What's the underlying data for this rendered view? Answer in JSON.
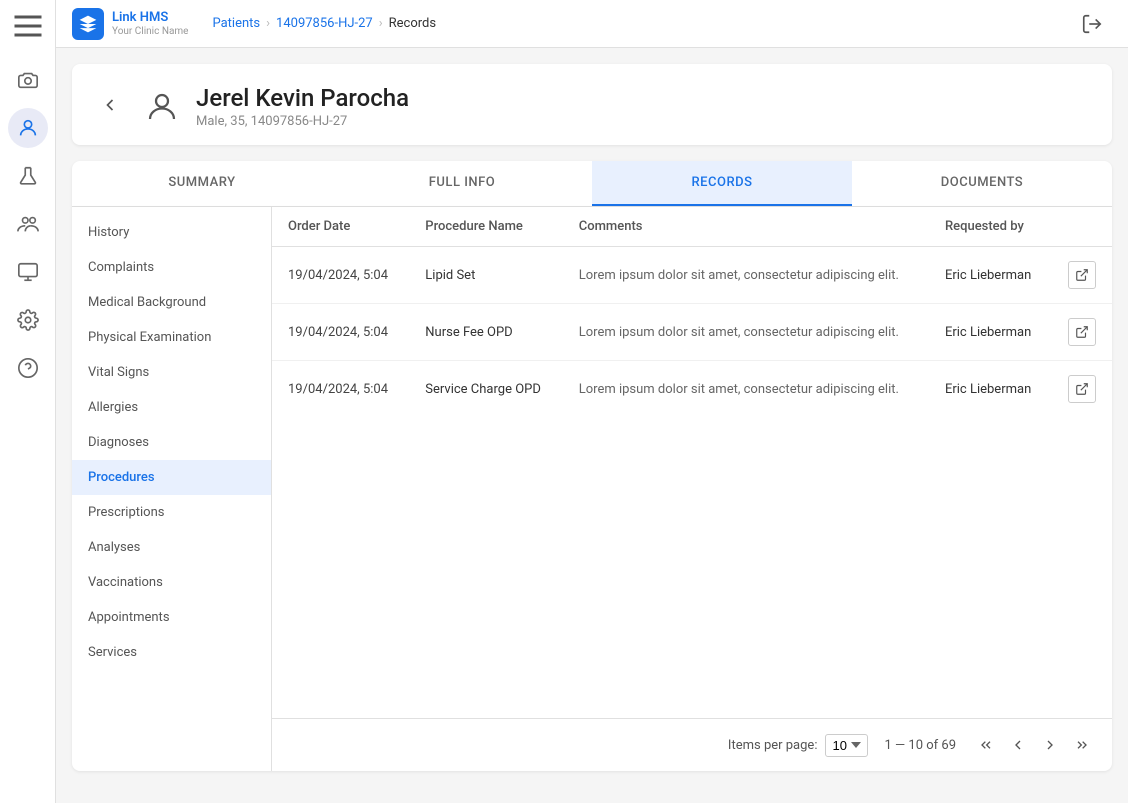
{
  "app": {
    "title": "Link HMS",
    "subtitle": "Your Clinic Name"
  },
  "breadcrumb": {
    "patients": "Patients",
    "patient_id": "14097856-HJ-27",
    "current": "Records"
  },
  "patient": {
    "name": "Jerel Kevin Parocha",
    "meta": "Male, 35, 14097856-HJ-27"
  },
  "tabs": [
    {
      "label": "SUMMARY",
      "active": false
    },
    {
      "label": "FULL INFO",
      "active": false
    },
    {
      "label": "RECORDS",
      "active": true
    },
    {
      "label": "DOCUMENTS",
      "active": false
    }
  ],
  "sidebar_menu": [
    {
      "label": "History",
      "active": false
    },
    {
      "label": "Complaints",
      "active": false
    },
    {
      "label": "Medical Background",
      "active": false
    },
    {
      "label": "Physical Examination",
      "active": false
    },
    {
      "label": "Vital Signs",
      "active": false
    },
    {
      "label": "Allergies",
      "active": false
    },
    {
      "label": "Diagnoses",
      "active": false
    },
    {
      "label": "Procedures",
      "active": true
    },
    {
      "label": "Prescriptions",
      "active": false
    },
    {
      "label": "Analyses",
      "active": false
    },
    {
      "label": "Vaccinations",
      "active": false
    },
    {
      "label": "Appointments",
      "active": false
    },
    {
      "label": "Services",
      "active": false
    }
  ],
  "table": {
    "columns": [
      "Order Date",
      "Procedure Name",
      "Comments",
      "Requested by"
    ],
    "rows": [
      {
        "order_date": "19/04/2024, 5:04",
        "procedure_name": "Lipid Set",
        "comments": "Lorem ipsum dolor sit amet, consectetur adipiscing elit.",
        "requested_by": "Eric Lieberman"
      },
      {
        "order_date": "19/04/2024, 5:04",
        "procedure_name": "Nurse Fee OPD",
        "comments": "Lorem ipsum dolor sit amet, consectetur adipiscing elit.",
        "requested_by": "Eric Lieberman"
      },
      {
        "order_date": "19/04/2024, 5:04",
        "procedure_name": "Service Charge OPD",
        "comments": "Lorem ipsum dolor sit amet, consectetur adipiscing elit.",
        "requested_by": "Eric Lieberman"
      }
    ]
  },
  "pagination": {
    "items_per_page_label": "Items per page:",
    "per_page_value": "10",
    "range": "1 — 10 of 69"
  }
}
